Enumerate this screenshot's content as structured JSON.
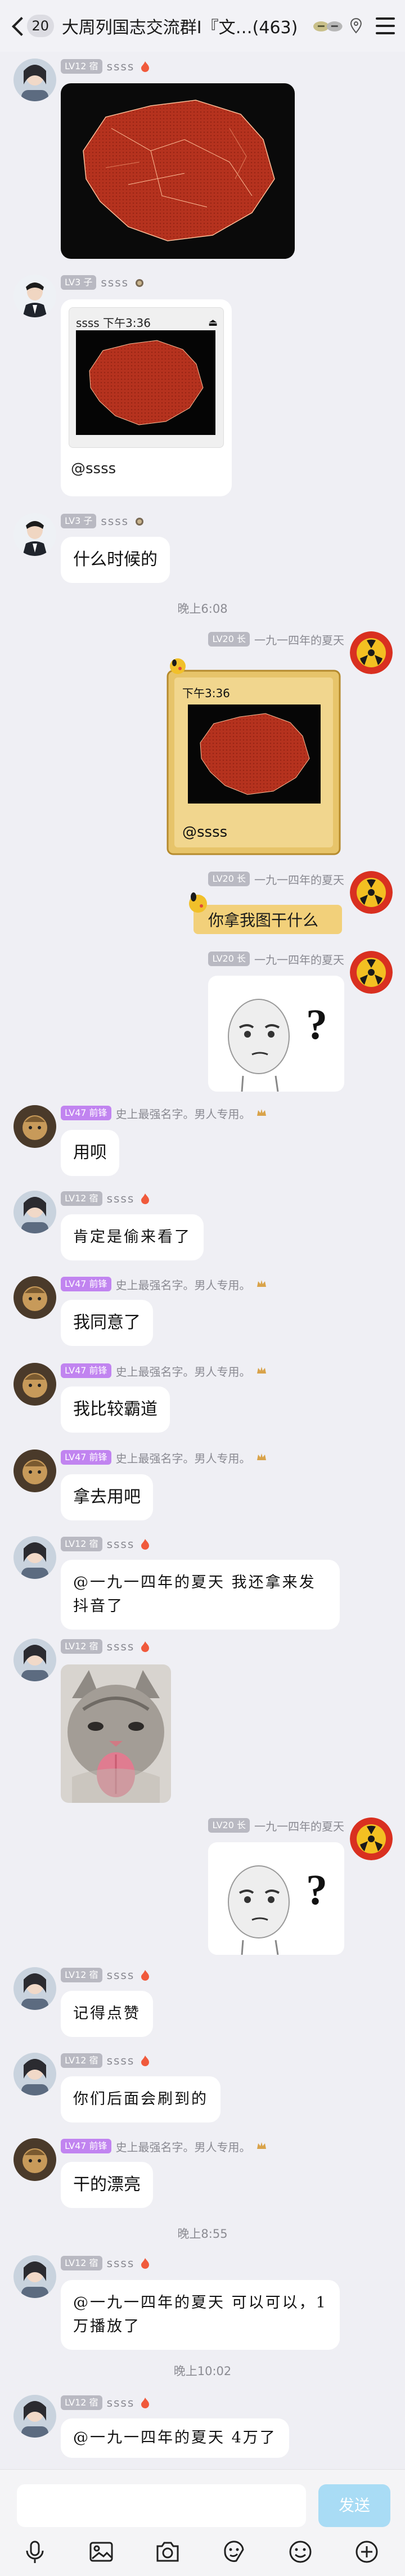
{
  "header": {
    "unread_count": "20",
    "title": "大周列国志交流群I『文…(463)"
  },
  "messages": {
    "m1": {
      "level": "LV12 宿",
      "nick": "ꜱꜱꜱꜱ"
    },
    "m2": {
      "level": "LV3 子",
      "nick": "ꜱꜱꜱꜱ",
      "quote_time": "下午3:36",
      "quote_sender": "@ꜱꜱꜱꜱ"
    },
    "m3": {
      "level": "LV3 子",
      "nick": "ꜱꜱꜱꜱ",
      "text": "什么时候的"
    },
    "t1": "晚上6:08",
    "m4": {
      "level": "LV20 长",
      "nick": "一九一四年的夏天",
      "quote_time": "下午3:36",
      "quote_sender": "@ꜱꜱꜱꜱ"
    },
    "m5": {
      "level": "LV20 长",
      "nick": "一九一四年的夏天",
      "text": "你拿我图干什么"
    },
    "m6": {
      "level": "LV20 长",
      "nick": "一九一四年的夏天"
    },
    "m7": {
      "level": "LV47 前锋",
      "nick": "史上最强名字。男人专用。",
      "text": "用呗"
    },
    "m8": {
      "level": "LV12 宿",
      "nick": "ꜱꜱꜱꜱ",
      "text": "肯定是偷来看了"
    },
    "m9": {
      "level": "LV47 前锋",
      "nick": "史上最强名字。男人专用。",
      "text": "我同意了"
    },
    "m10": {
      "level": "LV47 前锋",
      "nick": "史上最强名字。男人专用。",
      "text": "我比较霸道"
    },
    "m11": {
      "level": "LV47 前锋",
      "nick": "史上最强名字。男人专用。",
      "text": "拿去用吧"
    },
    "m12": {
      "level": "LV12 宿",
      "nick": "ꜱꜱꜱꜱ",
      "text": "@一九一四年的夏天 我还拿来发抖音了"
    },
    "m13": {
      "level": "LV12 宿",
      "nick": "ꜱꜱꜱꜱ"
    },
    "m14": {
      "level": "LV20 长",
      "nick": "一九一四年的夏天"
    },
    "m15": {
      "level": "LV12 宿",
      "nick": "ꜱꜱꜱꜱ",
      "text": "记得点赞"
    },
    "m16": {
      "level": "LV12 宿",
      "nick": "ꜱꜱꜱꜱ",
      "text": "你们后面会刷到的"
    },
    "m17": {
      "level": "LV47 前锋",
      "nick": "史上最强名字。男人专用。",
      "text": "干的漂亮"
    },
    "t2": "晚上8:55",
    "m18": {
      "level": "LV12 宿",
      "nick": "ꜱꜱꜱꜱ",
      "text": "@一九一四年的夏天 可以可以，1万播放了"
    },
    "t3": "晚上10:02",
    "m19": {
      "level": "LV12 宿",
      "nick": "ꜱꜱꜱꜱ",
      "text": "@一九一四年的夏天 4万了"
    }
  },
  "composer": {
    "send_label": "发送"
  },
  "colors": {
    "accent_send": "#a9dcf5",
    "lv_purple": "#c184f0",
    "lv_grey": "#b9b9c2"
  },
  "icons": [
    "back-icon",
    "menu-icon",
    "mic-icon",
    "image-icon",
    "camera-icon",
    "sticker-icon",
    "emoji-icon",
    "plus-icon"
  ]
}
